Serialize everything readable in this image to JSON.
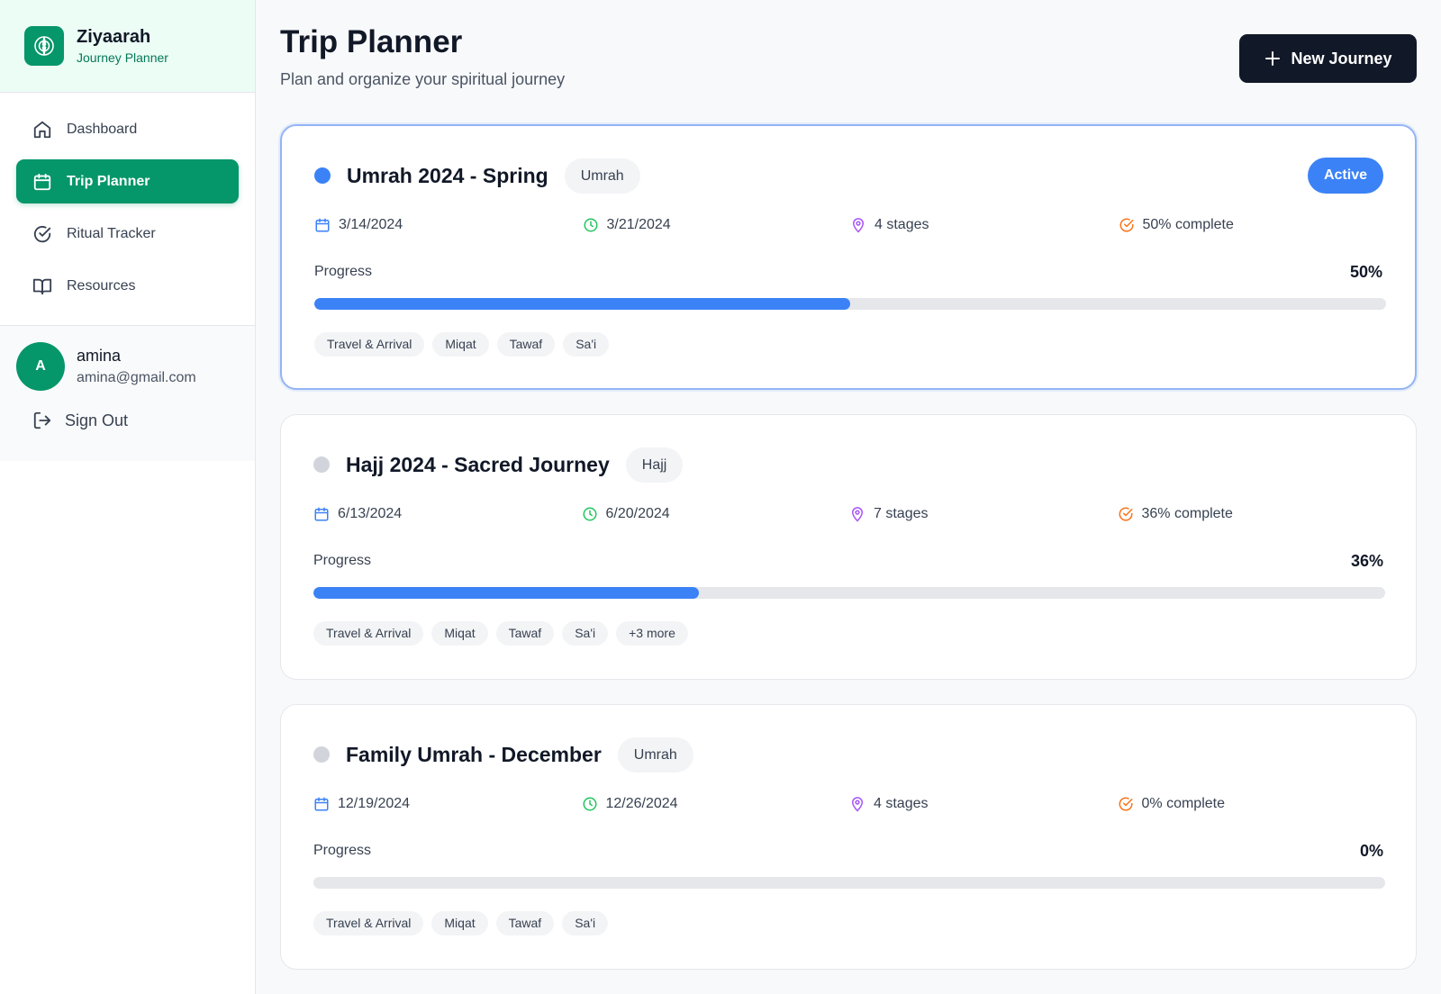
{
  "brand": {
    "name": "Ziyaarah",
    "subtitle": "Journey Planner"
  },
  "nav": [
    {
      "label": "Dashboard",
      "icon": "home-icon",
      "active": false
    },
    {
      "label": "Trip Planner",
      "icon": "calendar-icon",
      "active": true
    },
    {
      "label": "Ritual Tracker",
      "icon": "check-circle-icon",
      "active": false
    },
    {
      "label": "Resources",
      "icon": "book-icon",
      "active": false
    }
  ],
  "user": {
    "initial": "A",
    "name": "amina",
    "email": "amina@gmail.com",
    "signout_label": "Sign Out"
  },
  "header": {
    "title": "Trip Planner",
    "subtitle": "Plan and organize your spiritual journey",
    "new_button_label": "New Journey"
  },
  "colors": {
    "primary": "#059669",
    "accent": "#3b82f6",
    "dark": "#111827",
    "clock": "#22c55e",
    "pin": "#a855f7",
    "check": "#f97316"
  },
  "trips": [
    {
      "title": "Umrah 2024 - Spring",
      "type": "Umrah",
      "active": true,
      "status_label": "Active",
      "start_date": "3/14/2024",
      "end_date": "3/21/2024",
      "stages": "4 stages",
      "complete_label": "50% complete",
      "progress_label": "Progress",
      "progress_text": "50%",
      "progress": 50,
      "tags": [
        "Travel & Arrival",
        "Miqat",
        "Tawaf",
        "Sa'i"
      ]
    },
    {
      "title": "Hajj 2024 - Sacred Journey",
      "type": "Hajj",
      "active": false,
      "status_label": "",
      "start_date": "6/13/2024",
      "end_date": "6/20/2024",
      "stages": "7 stages",
      "complete_label": "36% complete",
      "progress_label": "Progress",
      "progress_text": "36%",
      "progress": 36,
      "tags": [
        "Travel & Arrival",
        "Miqat",
        "Tawaf",
        "Sa'i",
        "+3 more"
      ]
    },
    {
      "title": "Family Umrah - December",
      "type": "Umrah",
      "active": false,
      "status_label": "",
      "start_date": "12/19/2024",
      "end_date": "12/26/2024",
      "stages": "4 stages",
      "complete_label": "0% complete",
      "progress_label": "Progress",
      "progress_text": "0%",
      "progress": 0,
      "tags": [
        "Travel & Arrival",
        "Miqat",
        "Tawaf",
        "Sa'i"
      ]
    }
  ]
}
